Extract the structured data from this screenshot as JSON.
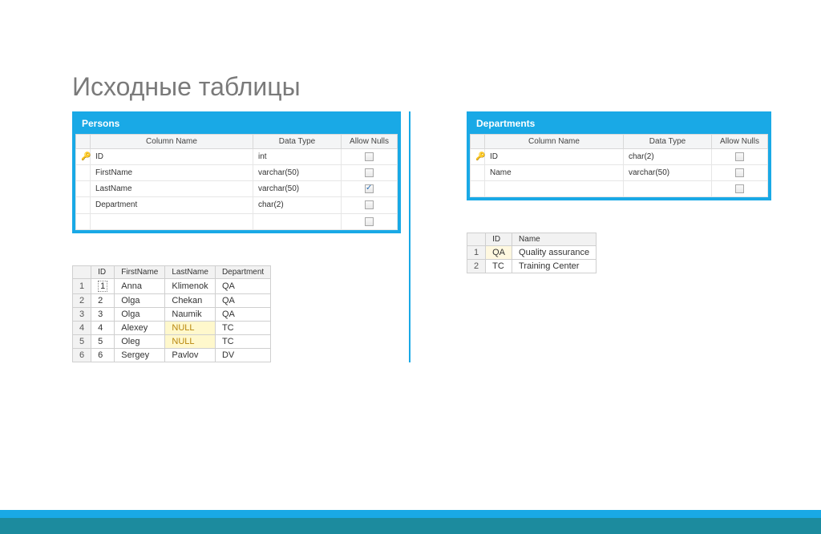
{
  "title": "Исходные таблицы",
  "schema_headers": {
    "col_name": "Column Name",
    "data_type": "Data Type",
    "allow_nulls": "Allow Nulls"
  },
  "persons_schema": {
    "title": "Persons",
    "cols": [
      {
        "pk": true,
        "name": "ID",
        "type": "int",
        "allow": false
      },
      {
        "pk": false,
        "name": "FirstName",
        "type": "varchar(50)",
        "allow": false
      },
      {
        "pk": false,
        "name": "LastName",
        "type": "varchar(50)",
        "allow": true
      },
      {
        "pk": false,
        "name": "Department",
        "type": "char(2)",
        "allow": false
      },
      {
        "pk": false,
        "name": "",
        "type": "",
        "allow": false
      }
    ]
  },
  "departments_schema": {
    "title": "Departments",
    "cols": [
      {
        "pk": true,
        "name": "ID",
        "type": "char(2)",
        "allow": false
      },
      {
        "pk": false,
        "name": "Name",
        "type": "varchar(50)",
        "allow": false
      },
      {
        "pk": false,
        "name": "",
        "type": "",
        "allow": false
      }
    ]
  },
  "persons_data": {
    "headers": [
      "ID",
      "FirstName",
      "LastName",
      "Department"
    ],
    "rows": [
      {
        "n": "1",
        "c": [
          "1",
          "Anna",
          "Klimenok",
          "QA"
        ]
      },
      {
        "n": "2",
        "c": [
          "2",
          "Olga",
          "Chekan",
          "QA"
        ]
      },
      {
        "n": "3",
        "c": [
          "3",
          "Olga",
          "Naumik",
          "QA"
        ]
      },
      {
        "n": "4",
        "c": [
          "4",
          "Alexey",
          "NULL",
          "TC"
        ]
      },
      {
        "n": "5",
        "c": [
          "5",
          "Oleg",
          "NULL",
          "TC"
        ]
      },
      {
        "n": "6",
        "c": [
          "6",
          "Sergey",
          "Pavlov",
          "DV"
        ]
      }
    ]
  },
  "departments_data": {
    "headers": [
      "ID",
      "Name"
    ],
    "rows": [
      {
        "n": "1",
        "c": [
          "QA",
          "Quality assurance"
        ]
      },
      {
        "n": "2",
        "c": [
          "TC",
          "Training Center"
        ]
      }
    ]
  }
}
